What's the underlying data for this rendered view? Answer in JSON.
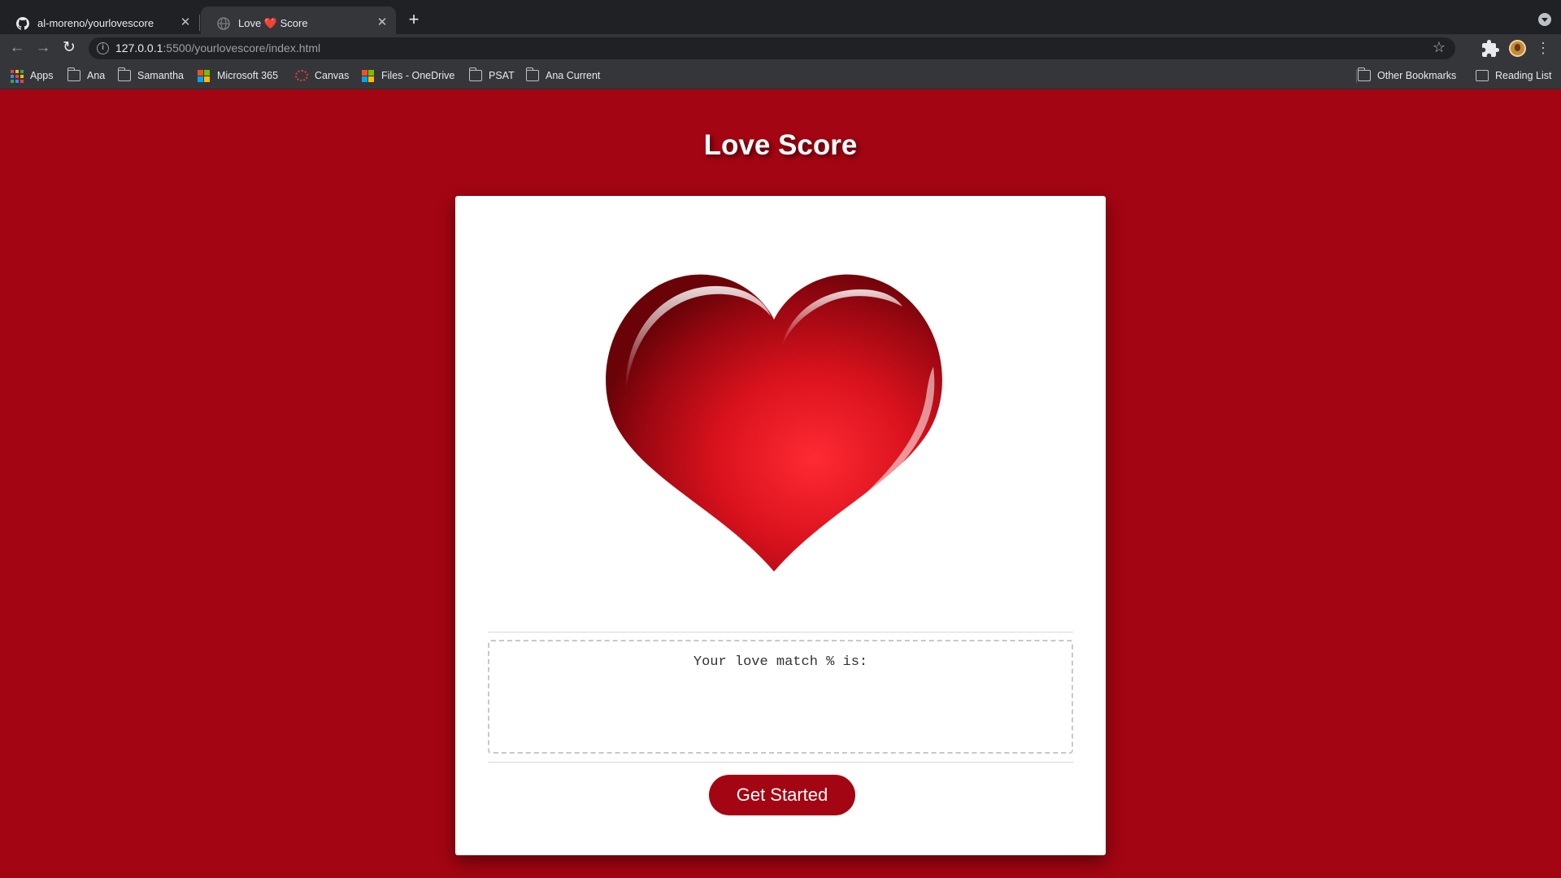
{
  "browser": {
    "tabs": [
      {
        "title": "al-moreno/yourlovescore",
        "icon": "github-icon",
        "active": false
      },
      {
        "title": "Love ❤️ Score",
        "icon": "globe-icon",
        "active": true
      }
    ],
    "url_host": "127.0.0.1",
    "url_path": ":5500/yourlovescore/index.html",
    "bookmarks": [
      {
        "label": "Apps",
        "icon": "apps-grid-icon"
      },
      {
        "label": "Ana",
        "icon": "folder-icon"
      },
      {
        "label": "Samantha",
        "icon": "folder-icon"
      },
      {
        "label": "Microsoft 365",
        "icon": "microsoft-icon"
      },
      {
        "label": "Canvas",
        "icon": "canvas-icon"
      },
      {
        "label": "Files - OneDrive",
        "icon": "microsoft-icon"
      },
      {
        "label": "PSAT",
        "icon": "folder-icon"
      },
      {
        "label": "Ana Current",
        "icon": "folder-icon"
      }
    ],
    "other_bookmarks": "Other Bookmarks",
    "reading_list": "Reading List"
  },
  "page": {
    "title": "Love Score",
    "result_label": "Your love match % is:",
    "button_label": "Get Started"
  },
  "colors": {
    "background": "#a40512",
    "card": "#ffffff",
    "button": "#a40512",
    "heart": "#e31c25"
  }
}
